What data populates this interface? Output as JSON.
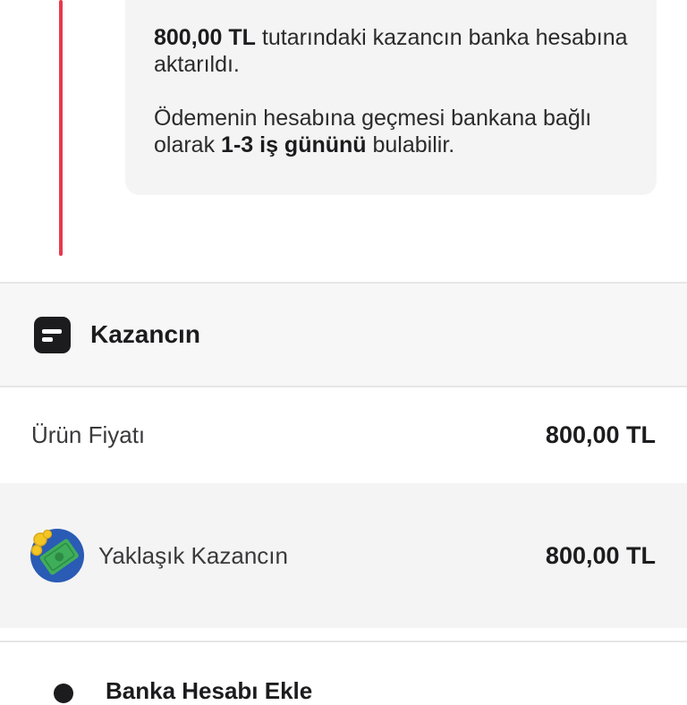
{
  "notice": {
    "amount": "800,00 TL",
    "line1_rest": " tutarındaki kazancın banka hesabına aktarıldı.",
    "line2_start": "Ödemenin hesabına geçmesi bankana bağlı olarak ",
    "duration": "1-3 iş gününü",
    "line2_end": " bulabilir."
  },
  "earnings": {
    "title": "Kazancın",
    "product_price_label": "Ürün Fiyatı",
    "product_price_value": "800,00 TL",
    "approx_earnings_label": "Yaklaşık Kazancın",
    "approx_earnings_value": "800,00 TL"
  },
  "bank": {
    "add_label": "Banka Hesabı Ekle"
  },
  "icons": {
    "earnings_header": "document-icon",
    "approx_earnings": "money-coins-icon",
    "bank": "bank-icon"
  },
  "colors": {
    "timeline_accent": "#e8384f",
    "card_background": "#f4f4f4",
    "money_green": "#3fae5a",
    "money_blue": "#2a5bb5",
    "coin_yellow": "#f3c623"
  }
}
